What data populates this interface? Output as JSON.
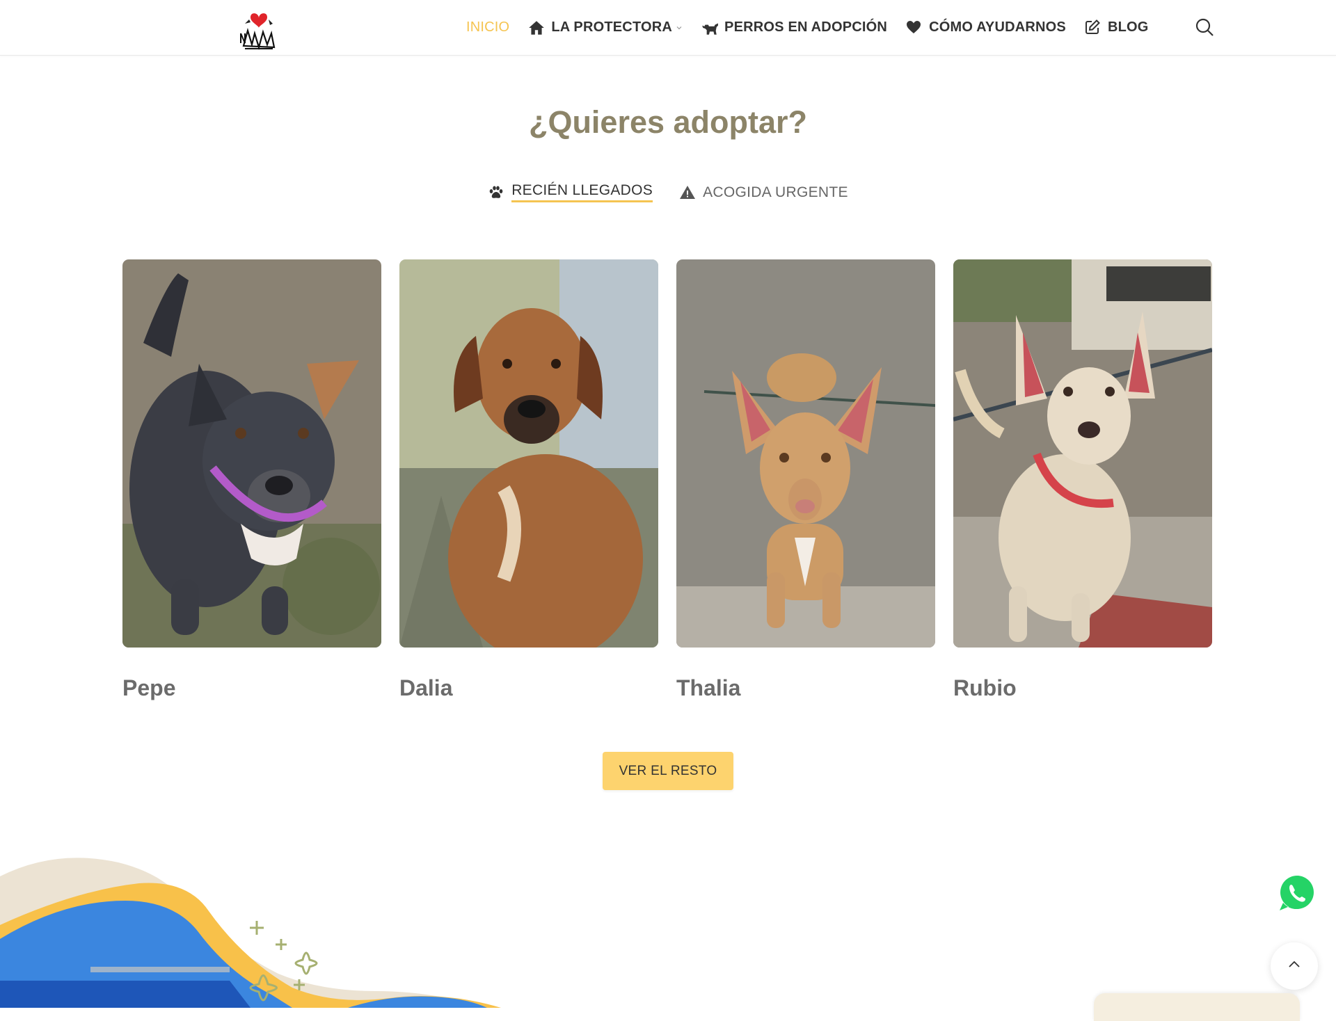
{
  "header": {
    "logo_name": "no-me-abandones-logo",
    "nav": [
      {
        "label": "INICIO",
        "icon": "",
        "active": true
      },
      {
        "label": "LA PROTECTORA",
        "icon": "house-icon",
        "has_dropdown": true
      },
      {
        "label": "PERROS EN ADOPCIÓN",
        "icon": "dog-icon"
      },
      {
        "label": "CÓMO AYUDARNOS",
        "icon": "heart-icon"
      },
      {
        "label": "BLOG",
        "icon": "edit-icon"
      }
    ],
    "search_icon": "search-icon"
  },
  "main": {
    "title": "¿Quieres adoptar?",
    "tabs": [
      {
        "label": "RECIÉN LLEGADOS",
        "icon": "paw-icon",
        "active": true
      },
      {
        "label": "ACOGIDA URGENTE",
        "icon": "warning-icon",
        "active": false
      }
    ],
    "dogs": [
      {
        "name": "Pepe"
      },
      {
        "name": "Dalia"
      },
      {
        "name": "Thalia"
      },
      {
        "name": "Rubio"
      }
    ],
    "cta_label": "VER EL RESTO"
  },
  "floating": {
    "whatsapp_icon": "whatsapp-icon",
    "scroll_top_icon": "chevron-up-icon"
  },
  "colors": {
    "accent": "#f5c451",
    "button": "#fdd36e",
    "title": "#8c8468",
    "whatsapp": "#25d366"
  }
}
